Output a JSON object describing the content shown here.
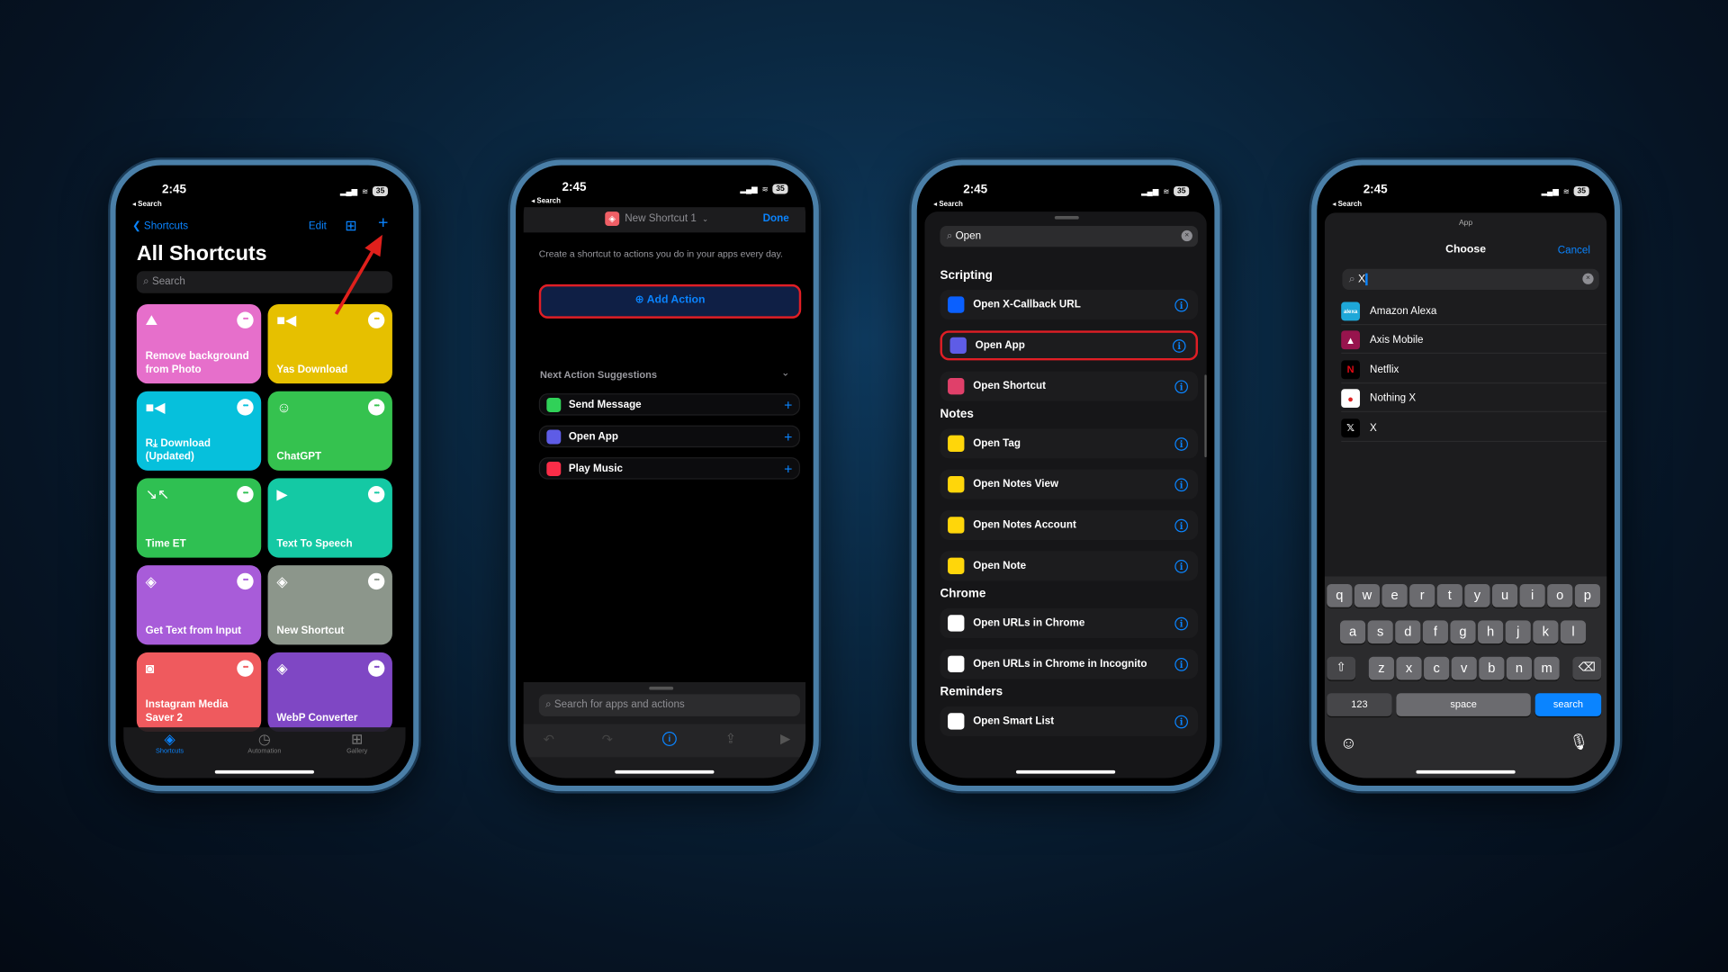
{
  "status": {
    "time": "2:45",
    "back": "◂ Search",
    "battery": "35"
  },
  "phone1": {
    "back_label": "Shortcuts",
    "edit": "Edit",
    "title": "All Shortcuts",
    "search_placeholder": "Search",
    "tiles": [
      {
        "label": "Remove background from Photo",
        "icon": "mountain-icon",
        "glyph": "⛰",
        "color": "#e66fcb"
      },
      {
        "label": "Yas Download",
        "icon": "video-camera-icon",
        "glyph": "■◀",
        "color": "#e6c000"
      },
      {
        "label": "R⤓ Download (Updated)",
        "icon": "video-camera-icon",
        "glyph": "■◀",
        "color": "#06c0dc"
      },
      {
        "label": "ChatGPT",
        "icon": "brain-head-icon",
        "glyph": "☺",
        "color": "#35c24f"
      },
      {
        "label": "Time ET",
        "icon": "compress-arrows-icon",
        "glyph": "↘↖",
        "color": "#2fc052"
      },
      {
        "label": "Text To Speech",
        "icon": "play-icon",
        "glyph": "▶",
        "color": "#14c9a4"
      },
      {
        "label": "Get Text from Input",
        "icon": "layers-icon",
        "glyph": "◈",
        "color": "#a85cd9"
      },
      {
        "label": "New Shortcut",
        "icon": "layers-icon",
        "glyph": "◈",
        "color": "#8c968b"
      },
      {
        "label": "Instagram Media Saver 2",
        "icon": "camera-icon",
        "glyph": "◙",
        "color": "#ef5a5e"
      },
      {
        "label": "WebP Converter",
        "icon": "layers-icon",
        "glyph": "◈",
        "color": "#7f47c4"
      }
    ],
    "tabs": [
      {
        "label": "Shortcuts",
        "active": true
      },
      {
        "label": "Automation"
      },
      {
        "label": "Gallery"
      }
    ]
  },
  "phone2": {
    "shortcut_name": "New Shortcut 1",
    "done": "Done",
    "description": "Create a shortcut to actions you do in your apps every day.",
    "add_action": "Add Action",
    "suggestions_header": "Next Action Suggestions",
    "suggestions": [
      {
        "label": "Send Message",
        "icon": "messages-icon",
        "color": "#30d158"
      },
      {
        "label": "Open App",
        "icon": "open-app-icon",
        "color": "#5e5ce6"
      },
      {
        "label": "Play Music",
        "icon": "music-icon",
        "color": "#fa2d48"
      }
    ],
    "search_placeholder": "Search for apps and actions"
  },
  "phone3": {
    "search_value": "Open",
    "sections": [
      {
        "title": "Scripting",
        "items": [
          {
            "label": "Open X-Callback URL",
            "icon": "x-callback-icon",
            "color": "#0a60ff"
          },
          {
            "label": "Open App",
            "icon": "open-app-icon",
            "color": "#5e5ce6",
            "highlighted": true
          },
          {
            "label": "Open Shortcut",
            "icon": "shortcuts-icon",
            "color": "#e0406a"
          }
        ]
      },
      {
        "title": "Notes",
        "items": [
          {
            "label": "Open Tag",
            "icon": "notes-icon",
            "color": "#ffd60a"
          },
          {
            "label": "Open Notes View",
            "icon": "notes-icon",
            "color": "#ffd60a"
          },
          {
            "label": "Open Notes Account",
            "icon": "notes-icon",
            "color": "#ffd60a"
          },
          {
            "label": "Open Note",
            "icon": "notes-icon",
            "color": "#ffd60a"
          }
        ]
      },
      {
        "title": "Chrome",
        "items": [
          {
            "label": "Open URLs in Chrome",
            "icon": "chrome-icon",
            "color": "#ffffff"
          },
          {
            "label": "Open URLs in Chrome in Incognito",
            "icon": "chrome-icon",
            "color": "#ffffff"
          }
        ]
      },
      {
        "title": "Reminders",
        "items": [
          {
            "label": "Open Smart List",
            "icon": "reminders-icon",
            "color": "#ffffff"
          }
        ]
      }
    ]
  },
  "phone4": {
    "sheet_caption": "App",
    "title": "Choose",
    "cancel": "Cancel",
    "search_value": "X",
    "apps": [
      {
        "label": "Amazon Alexa",
        "icon": "alexa-icon",
        "glyph": "alexa",
        "color": "#1ea7d8"
      },
      {
        "label": "Axis Mobile",
        "icon": "axis-icon",
        "glyph": "▲",
        "color": "#97144d"
      },
      {
        "label": "Netflix",
        "icon": "netflix-icon",
        "glyph": "N",
        "color": "#000000"
      },
      {
        "label": "Nothing X",
        "icon": "nothing-x-icon",
        "glyph": "●",
        "color": "#ffffff"
      },
      {
        "label": "X",
        "icon": "x-logo-icon",
        "glyph": "𝕏",
        "color": "#000000"
      }
    ],
    "keyboard": {
      "row1": [
        "q",
        "w",
        "e",
        "r",
        "t",
        "y",
        "u",
        "i",
        "o",
        "p"
      ],
      "row2": [
        "a",
        "s",
        "d",
        "f",
        "g",
        "h",
        "j",
        "k",
        "l"
      ],
      "row3": [
        "z",
        "x",
        "c",
        "v",
        "b",
        "n",
        "m"
      ],
      "numbers": "123",
      "space": "space",
      "search": "search"
    }
  }
}
